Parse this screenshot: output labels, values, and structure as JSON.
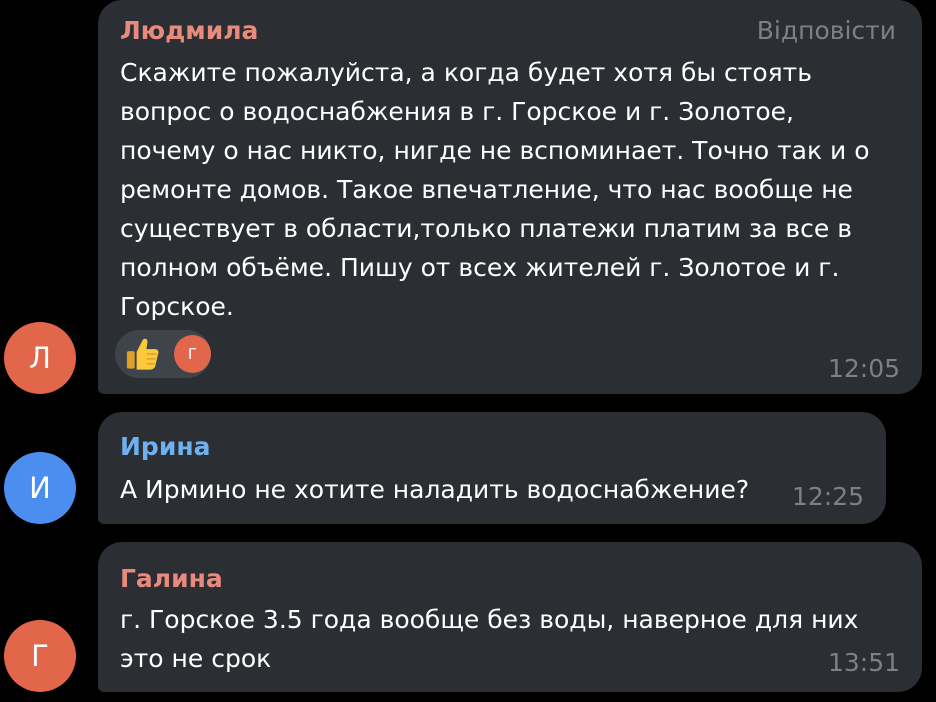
{
  "colors": {
    "background": "#000000",
    "bubble": "#2b2e33",
    "meta": "#7c8087",
    "text": "#ffffff",
    "name_lyudmila": "#e88a7c",
    "name_irina": "#6fb0ee",
    "name_galina": "#e88a7c"
  },
  "messages": [
    {
      "sender": "Людмила",
      "reply_label": "Відповісти",
      "text": "Скажите пожалуйста, а когда будет хотя бы стоять\nвопрос о водоснабжения в г. Горское и г. Золотое,\nпочему о нас никто, нигде не вспоминает. Точно так и о\nремонте домов. Такое впечатление, что нас вообще не\nсуществует в области,только платежи платим за все в\nполном объёме. Пишу от всех жителей г. Золотое и г.\nГорское.",
      "time": "12:05",
      "avatar_letter": "Л",
      "avatar_color": "#e2664a",
      "reactions": {
        "emoji_icon": "thumbs-up-icon",
        "reactor_letter": "Г",
        "reactor_color": "#e2664a"
      }
    },
    {
      "sender": "Ирина",
      "text": "А Ирмино не хотите наладить водоснабжение?",
      "time": "12:25",
      "avatar_letter": "И",
      "avatar_color": "#4b8ef0"
    },
    {
      "sender": "Галина",
      "text": "г. Горское 3.5 года вообще без воды, наверное для них\nэто не срок",
      "time": "13:51",
      "avatar_letter": "Г",
      "avatar_color": "#e2664a"
    }
  ]
}
